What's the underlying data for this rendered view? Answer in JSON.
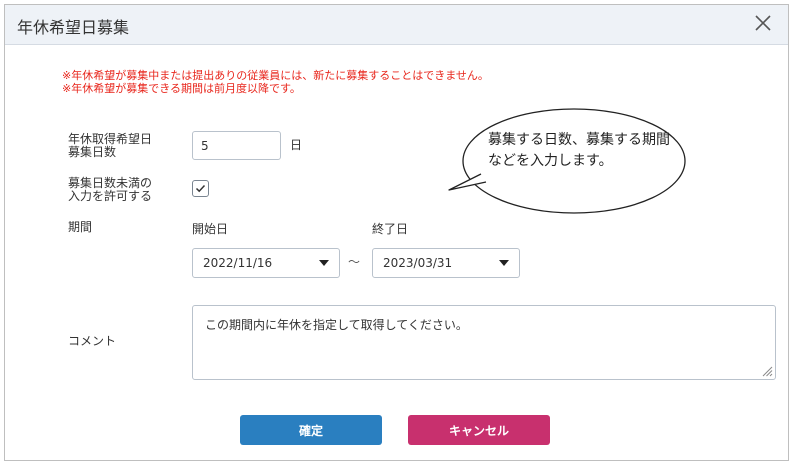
{
  "dialog": {
    "title": "年休希望日募集",
    "warnings": [
      "※年休希望が募集中または提出ありの従業員には、新たに募集することはできません。",
      "※年休希望が募集できる期間は前月度以降です。"
    ]
  },
  "form": {
    "days_label_line1": "年休取得希望日",
    "days_label_line2": "募集日数",
    "days_value": "5",
    "days_unit": "日",
    "allow_label_line1": "募集日数未満の",
    "allow_label_line2": "入力を許可する",
    "allow_checked": true,
    "period_label": "期間",
    "start_label": "開始日",
    "start_value": "2022/11/16",
    "tilde": "～",
    "end_label": "終了日",
    "end_value": "2023/03/31",
    "comment_label": "コメント",
    "comment_value": "この期間内に年休を指定して取得してください。"
  },
  "buttons": {
    "confirm_label": "確定",
    "cancel_label": "キャンセル"
  },
  "callout": {
    "text": "募集する日数、募集する期間などを入力します。"
  },
  "colors": {
    "confirm": "#2a7fc0",
    "cancel": "#c8306e",
    "warning": "#e8261c",
    "header_bg": "#eef2f7"
  }
}
